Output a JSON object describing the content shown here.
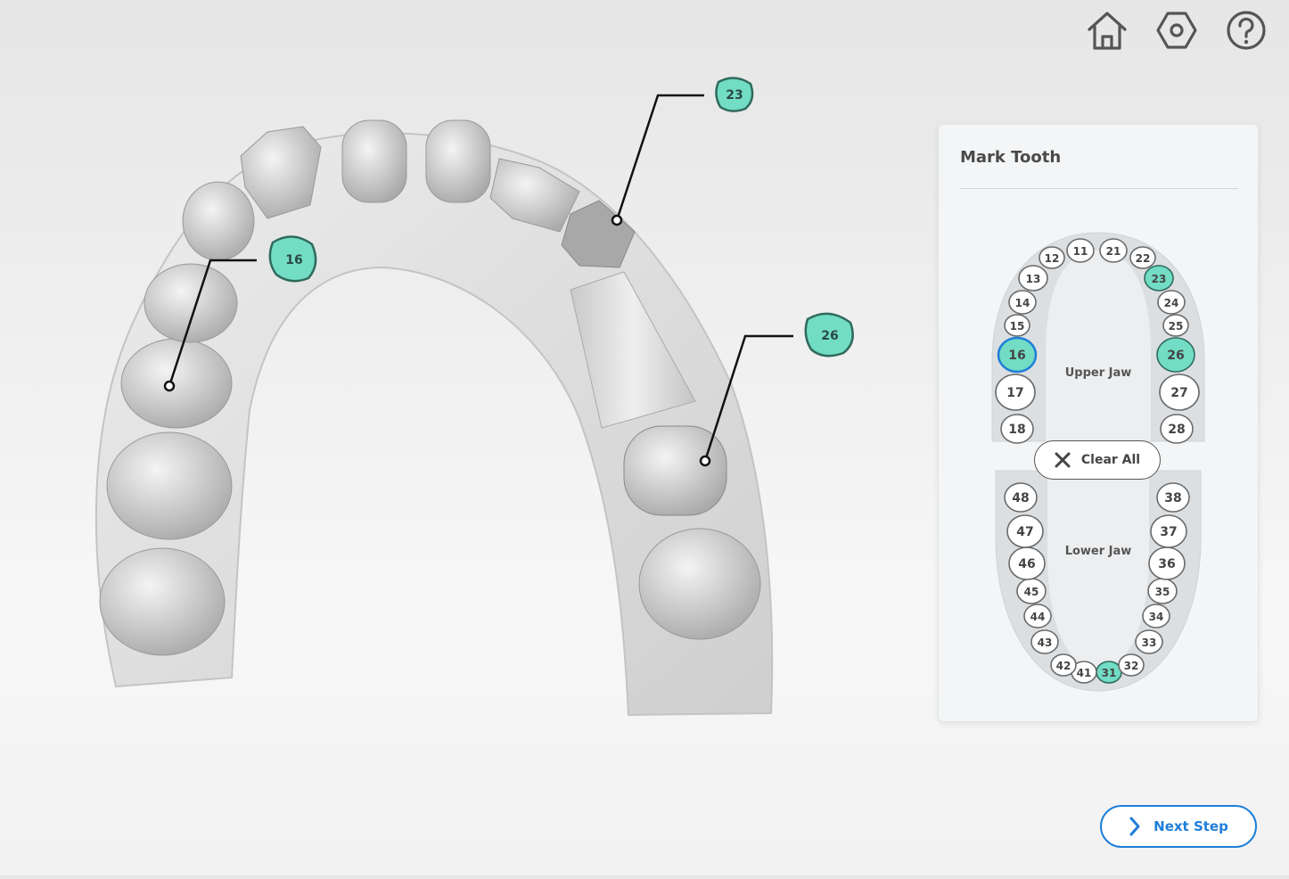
{
  "toolbar": {
    "home_icon": "home-icon",
    "settings_icon": "gear-icon",
    "help_icon": "help-icon"
  },
  "scene": {
    "callouts": [
      "23",
      "16",
      "26"
    ]
  },
  "panel": {
    "title": "Mark Tooth",
    "upper_jaw_label": "Upper Jaw",
    "lower_jaw_label": "Lower Jaw",
    "clear_all_label": "Clear All",
    "upper_teeth": [
      "11",
      "12",
      "13",
      "14",
      "15",
      "16",
      "17",
      "18",
      "21",
      "22",
      "23",
      "24",
      "25",
      "26",
      "27",
      "28"
    ],
    "lower_teeth": [
      "31",
      "32",
      "33",
      "34",
      "35",
      "36",
      "37",
      "38",
      "41",
      "42",
      "43",
      "44",
      "45",
      "46",
      "47",
      "48"
    ],
    "marked_teeth": [
      "16",
      "23",
      "26",
      "31"
    ],
    "selected_tooth": "16"
  },
  "footer": {
    "next_step_label": "Next Step"
  },
  "colors": {
    "accent": "#1e7ed8",
    "marked": "#72dcc4",
    "marked_border": "#2f6a5c",
    "selected_border": "#1e7ed8"
  }
}
